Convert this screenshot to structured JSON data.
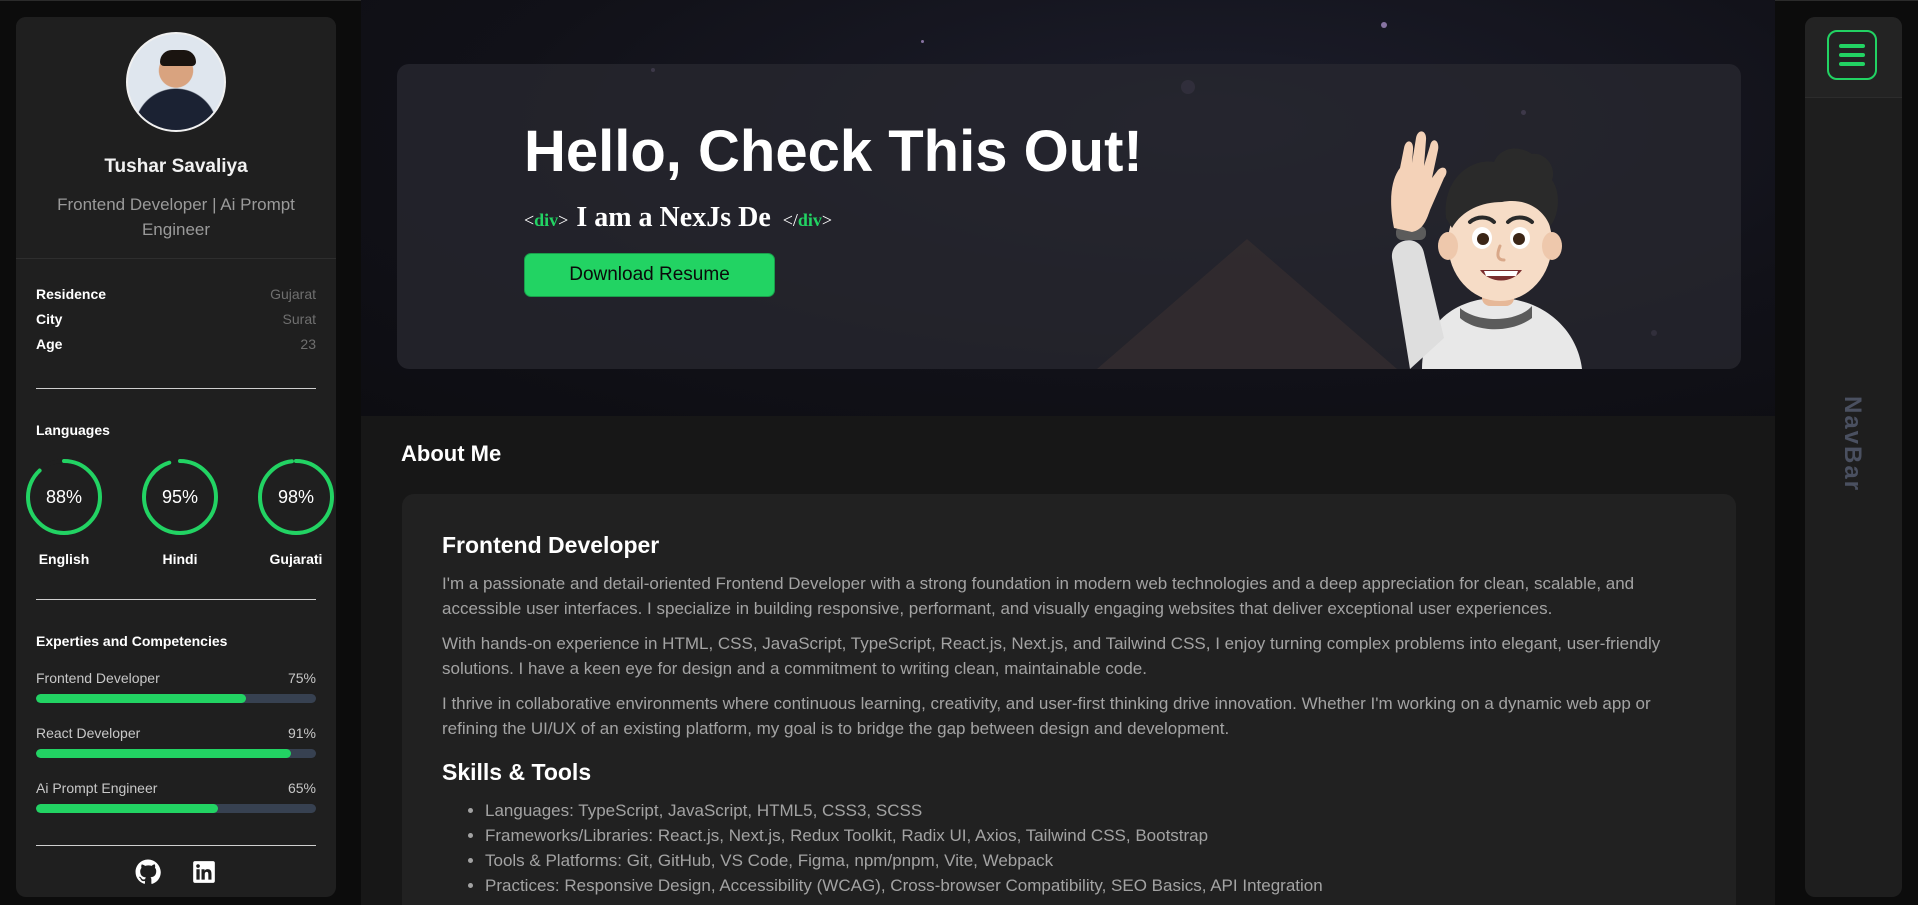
{
  "sidebar": {
    "name": "Tushar Savaliya",
    "role": "Frontend Developer | Ai Prompt Engineer",
    "info": [
      {
        "label": "Residence",
        "value": "Gujarat"
      },
      {
        "label": "City",
        "value": "Surat"
      },
      {
        "label": "Age",
        "value": "23"
      }
    ],
    "languages_title": "Languages",
    "languages": [
      {
        "name": "English",
        "percent_label": "88%",
        "percent": 88
      },
      {
        "name": "Hindi",
        "percent_label": "95%",
        "percent": 95
      },
      {
        "name": "Gujarati",
        "percent_label": "98%",
        "percent": 98
      }
    ],
    "skills_title": "Experties and Competencies",
    "skills": [
      {
        "name": "Frontend Developer",
        "percent_label": "75%",
        "percent": 75
      },
      {
        "name": "React Developer",
        "percent_label": "91%",
        "percent": 91
      },
      {
        "name": "Ai Prompt Engineer",
        "percent_label": "65%",
        "percent": 65
      }
    ],
    "socials": [
      {
        "icon": "github-icon"
      },
      {
        "icon": "linkedin-icon"
      }
    ]
  },
  "hero": {
    "title": "Hello, Check This Out!",
    "tag_open_lt": "<",
    "tag_name": "div",
    "tag_open_gt": ">",
    "typing_text": "I am a NexJs De",
    "tag_close_lt": "</",
    "tag_close_gt": ">",
    "button_label": "Download Resume"
  },
  "about": {
    "section_title": "About Me",
    "heading": "Frontend Developer",
    "paragraphs": [
      "I'm a passionate and detail-oriented Frontend Developer with a strong foundation in modern web technologies and a deep appreciation for clean, scalable, and accessible user interfaces. I specialize in building responsive, performant, and visually engaging websites that deliver exceptional user experiences.",
      "With hands-on experience in HTML, CSS, JavaScript, TypeScript, React.js, Next.js, and Tailwind CSS, I enjoy turning complex problems into elegant, user-friendly solutions. I have a keen eye for design and a commitment to writing clean, maintainable code.",
      "I thrive in collaborative environments where continuous learning, creativity, and user-first thinking drive innovation. Whether I'm working on a dynamic web app or refining the UI/UX of an existing platform, my goal is to bridge the gap between design and development."
    ],
    "skills_heading": "Skills & Tools",
    "skills_list": [
      "Languages: TypeScript, JavaScript, HTML5, CSS3, SCSS",
      "Frameworks/Libraries: React.js, Next.js, Redux Toolkit, Radix UI, Axios, Tailwind CSS, Bootstrap",
      "Tools & Platforms: Git, GitHub, VS Code, Figma, npm/pnpm, Vite, Webpack",
      "Practices: Responsive Design, Accessibility (WCAG), Cross-browser Compatibility, SEO Basics, API Integration"
    ]
  },
  "navbar": {
    "label": "NavBar",
    "menu_icon": "hamburger-menu-icon"
  },
  "colors": {
    "accent": "#22d363",
    "sidebar_bg": "#1f1f1f",
    "page_bg": "#171717",
    "card_bg": "#212121",
    "muted_text": "#a3a3a3"
  }
}
